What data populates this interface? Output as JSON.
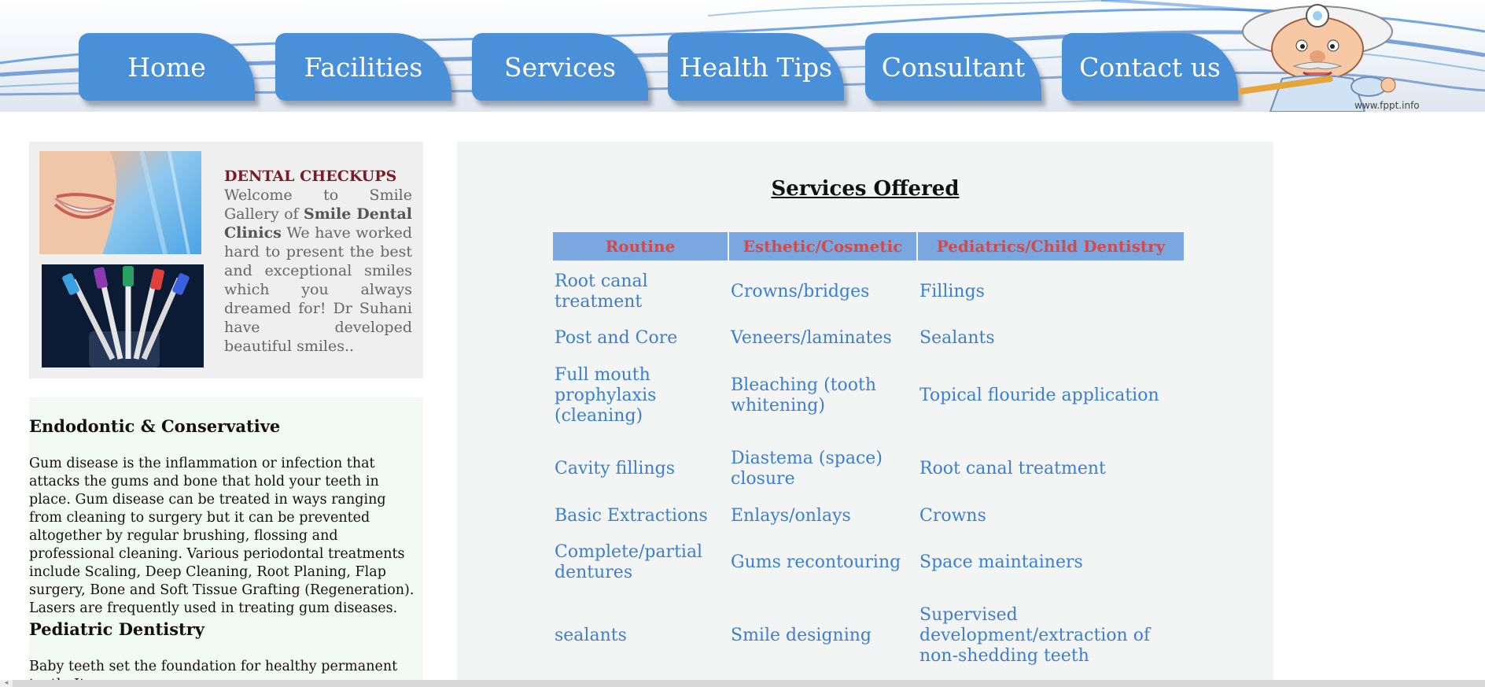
{
  "nav": {
    "items": [
      "Home",
      "Facilities",
      "Services",
      "Health Tips",
      "Consultant",
      "Contact us"
    ]
  },
  "banner": {
    "credit": "www.fppt.info"
  },
  "intro": {
    "heading": "DENTAL CHECKUPS",
    "text_before": "Welcome to Smile Gallery of ",
    "clinic_name": "Smile Dental Clinics",
    "text_after": " We have worked hard to present the best and exceptional smiles which you always dreamed for! Dr Suhani have developed beautiful smiles.."
  },
  "articles": [
    {
      "title": "Endodontic & Conservative",
      "body": "Gum disease is the inflammation or infection that attacks the gums and bone that hold your teeth in place. Gum disease can be treated in ways ranging from cleaning to surgery but it can be prevented altogether by regular brushing, flossing and professional cleaning. Various periodontal treatments include Scaling, Deep Cleaning, Root Planing, Flap surgery, Bone and Soft Tissue Grafting (Regeneration). Lasers are frequently used in treating gum diseases."
    },
    {
      "title": "Pediatric Dentistry",
      "body": "Baby teeth set the foundation for healthy permanent teeth. It"
    }
  ],
  "services": {
    "title": "Services Offered",
    "headers": [
      "Routine",
      "Esthetic/Cosmetic",
      "Pediatrics/Child Dentistry"
    ],
    "rows": [
      [
        "Root canal treatment",
        "Crowns/bridges",
        "Fillings"
      ],
      [
        "Post and Core",
        "Veneers/laminates",
        "Sealants"
      ],
      [
        "Full mouth prophylaxis (cleaning)",
        "Bleaching (tooth whitening)",
        "Topical flouride application"
      ],
      [
        "Cavity fillings",
        "Diastema (space) closure",
        "Root canal treatment"
      ],
      [
        "Basic Extractions",
        "Enlays/onlays",
        "Crowns"
      ],
      [
        "Complete/partial dentures",
        "Gums recontouring",
        "Space maintainers"
      ],
      [
        "sealants",
        "Smile designing",
        "Supervised development/extraction of non-shedding teeth"
      ]
    ]
  },
  "colors": {
    "nav_tab": "#4a90d9",
    "table_header_bg": "#7aa7e0",
    "table_header_text": "#d24a4a",
    "table_cell_text": "#3a7fd0",
    "intro_heading": "#7a1c24"
  }
}
